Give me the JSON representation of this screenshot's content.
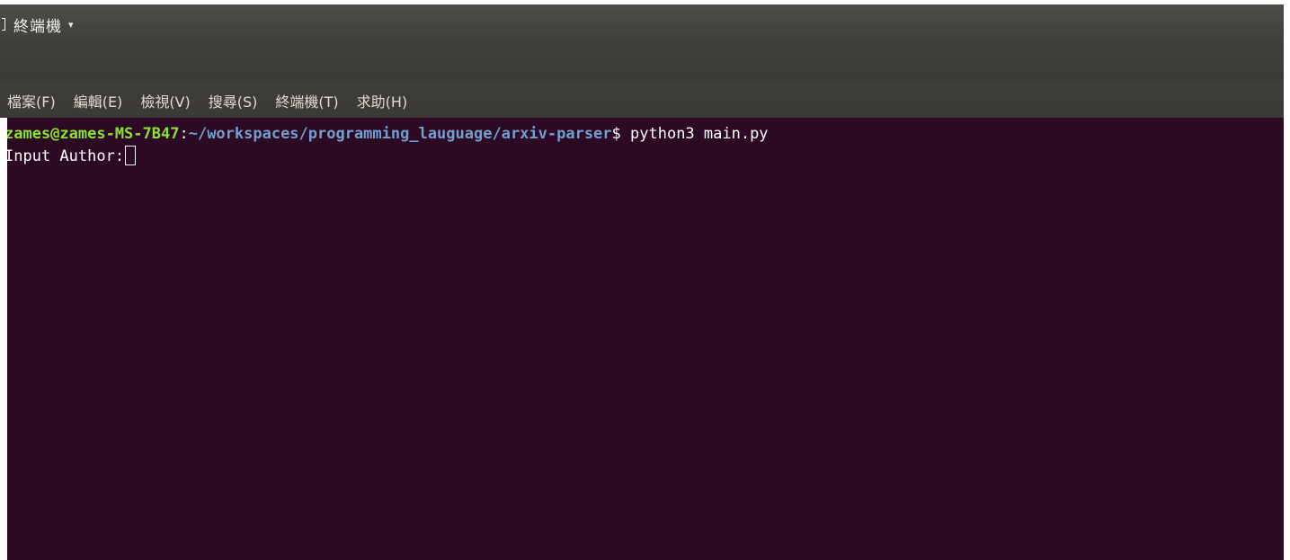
{
  "topbar": {
    "app_icon": "terminal-window-icon",
    "app_title": "終端機",
    "caret_icon": "caret-down-icon",
    "caret": "▾"
  },
  "menubar": {
    "items": [
      {
        "label": "檔案(F)"
      },
      {
        "label": "編輯(E)"
      },
      {
        "label": "檢視(V)"
      },
      {
        "label": "搜尋(S)"
      },
      {
        "label": "終端機(T)"
      },
      {
        "label": "求助(H)"
      }
    ]
  },
  "terminal": {
    "prompt": {
      "user_host": "zames@zames-MS-7B47",
      "colon": ":",
      "cwd": "~/workspaces/programming_lauguage/arxiv-parser",
      "dollar": "$",
      "command": " python3 main.py"
    },
    "output_prompt": "Input Author:",
    "colors": {
      "background": "#2c0a23",
      "user_host": "#8ae234",
      "cwd": "#729fcf",
      "text": "#ffffff"
    }
  }
}
